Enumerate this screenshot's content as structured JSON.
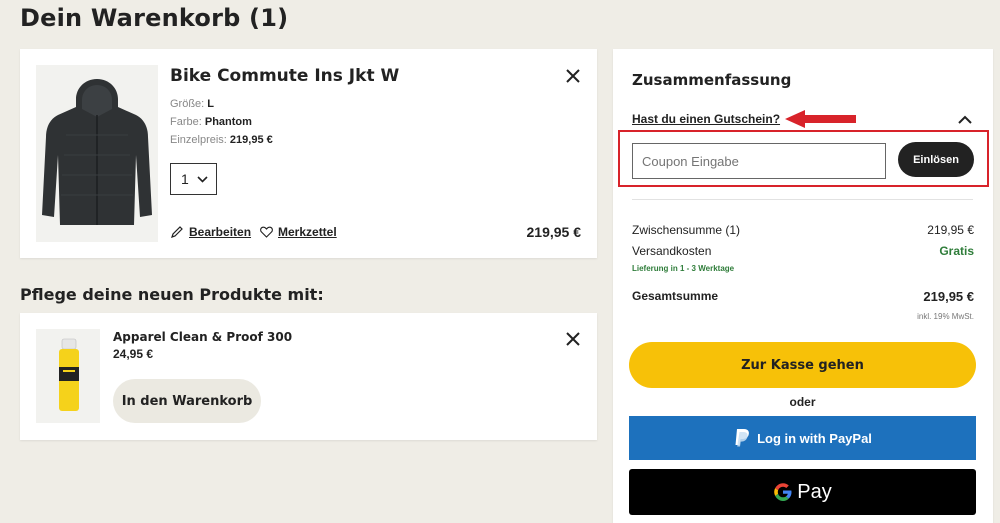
{
  "page": {
    "title": "Dein Warenkorb (1)"
  },
  "cart_item": {
    "name": "Bike Commute Ins Jkt W",
    "size_label": "Größe:",
    "size": "L",
    "color_label": "Farbe:",
    "color": "Phantom",
    "unit_price_label": "Einzelpreis:",
    "unit_price": "219,95 €",
    "quantity": "1",
    "edit_label": "Bearbeiten",
    "wishlist_label": "Merkzettel",
    "price": "219,95 €"
  },
  "care": {
    "heading": "Pflege deine neuen Produkte mit:",
    "name": "Apparel Clean & Proof 300",
    "price": "24,95 €",
    "add_label": "In den Warenkorb"
  },
  "summary": {
    "title": "Zusammenfassung",
    "voucher_link": "Hast du einen Gutschein?",
    "coupon_placeholder": "Coupon Eingabe",
    "redeem_label": "Einlösen",
    "subtotal_label": "Zwischensumme (1)",
    "subtotal": "219,95 €",
    "shipping_label": "Versandkosten",
    "shipping": "Gratis",
    "delivery": "Lieferung in 1 - 3 Werktage",
    "total_label": "Gesamtsumme",
    "total": "219,95 €",
    "vat": "inkl. 19% MwSt.",
    "checkout_label": "Zur Kasse gehen",
    "or_label": "oder",
    "paypal_label": "Log in with PayPal",
    "gpay_label": "Pay"
  },
  "colors": {
    "accent_yellow": "#f7c108",
    "paypal_blue": "#1d71bd",
    "highlight_red": "#d8232a",
    "success_green": "#2f7d3a"
  }
}
